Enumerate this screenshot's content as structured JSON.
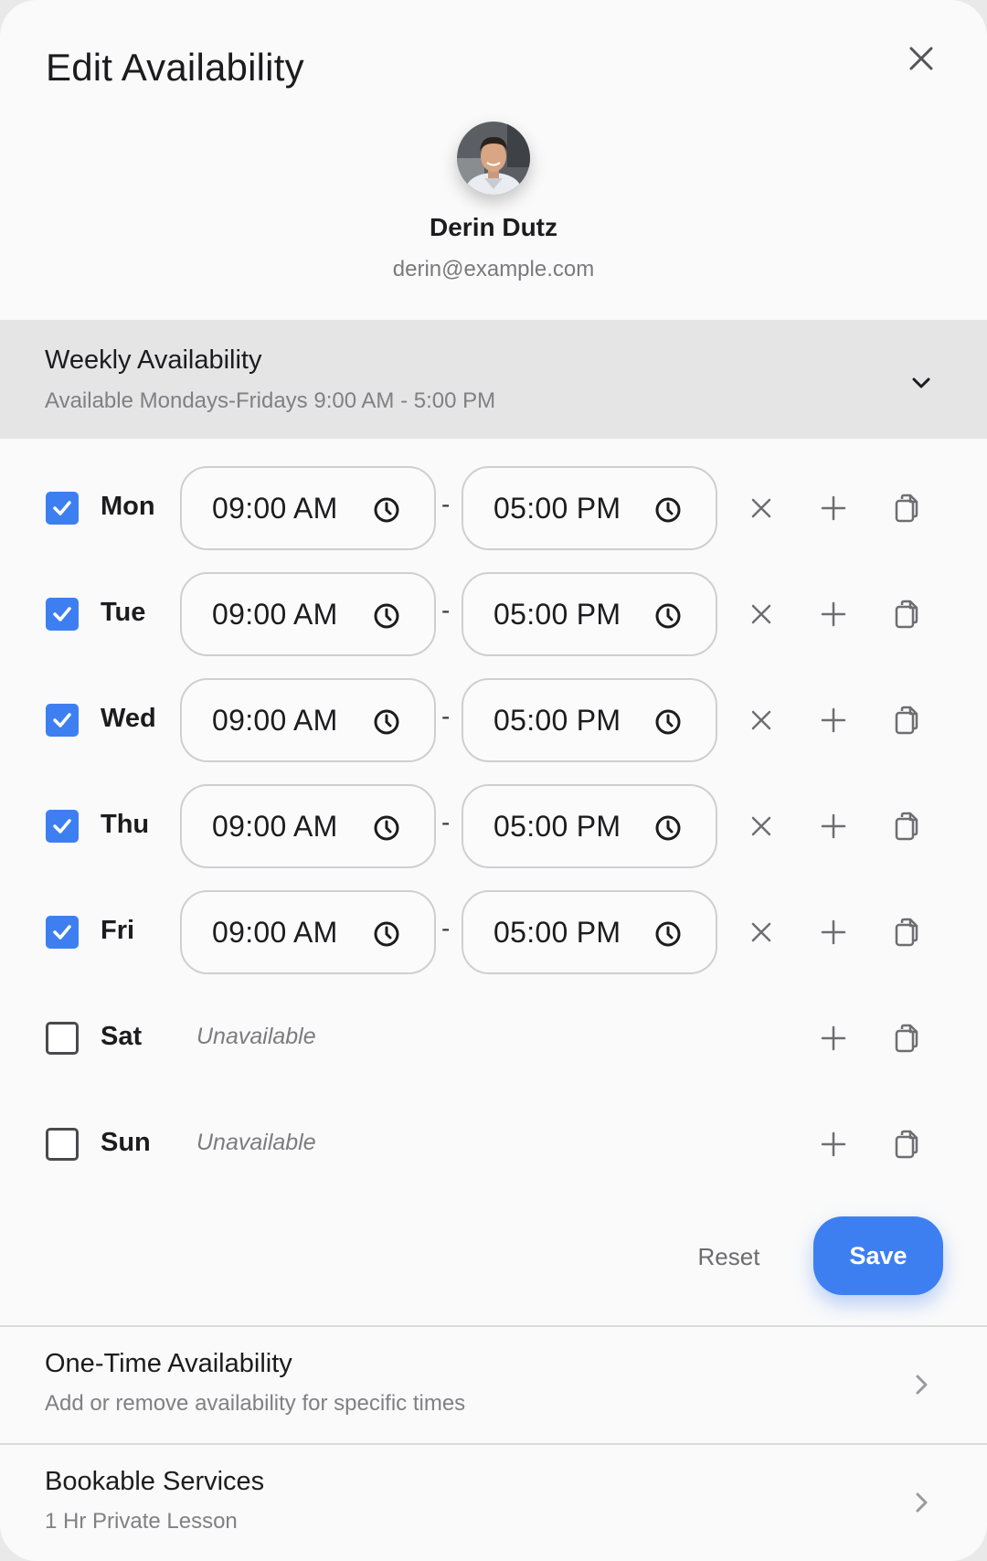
{
  "modal": {
    "title": "Edit Availability"
  },
  "user": {
    "name": "Derin Dutz",
    "email": "derin@example.com"
  },
  "weekly": {
    "title": "Weekly Availability",
    "summary": "Available Mondays-Fridays 9:00 AM - 5:00 PM"
  },
  "days": [
    {
      "label": "Mon",
      "checked": true,
      "start": "09:00 AM",
      "end": "05:00 PM"
    },
    {
      "label": "Tue",
      "checked": true,
      "start": "09:00 AM",
      "end": "05:00 PM"
    },
    {
      "label": "Wed",
      "checked": true,
      "start": "09:00 AM",
      "end": "05:00 PM"
    },
    {
      "label": "Thu",
      "checked": true,
      "start": "09:00 AM",
      "end": "05:00 PM"
    },
    {
      "label": "Fri",
      "checked": true,
      "start": "09:00 AM",
      "end": "05:00 PM"
    },
    {
      "label": "Sat",
      "checked": false,
      "status": "Unavailable"
    },
    {
      "label": "Sun",
      "checked": false,
      "status": "Unavailable"
    }
  ],
  "time_separator": "-",
  "actions": {
    "reset_label": "Reset",
    "save_label": "Save"
  },
  "one_time": {
    "title": "One-Time Availability",
    "subtitle": "Add or remove availability for specific times"
  },
  "services": {
    "title": "Bookable Services",
    "subtitle": "1 Hr Private Lesson"
  },
  "icons": {
    "close": "close-icon",
    "expand": "chevron-down-icon",
    "time": "clock-icon",
    "remove": "x-icon",
    "add": "plus-icon",
    "copy": "copy-icon",
    "navigate": "chevron-right-icon",
    "check": "check-icon"
  },
  "colors": {
    "accent": "#3d7ff0",
    "section_bg": "#e5e5e6",
    "muted_text": "#808085"
  }
}
